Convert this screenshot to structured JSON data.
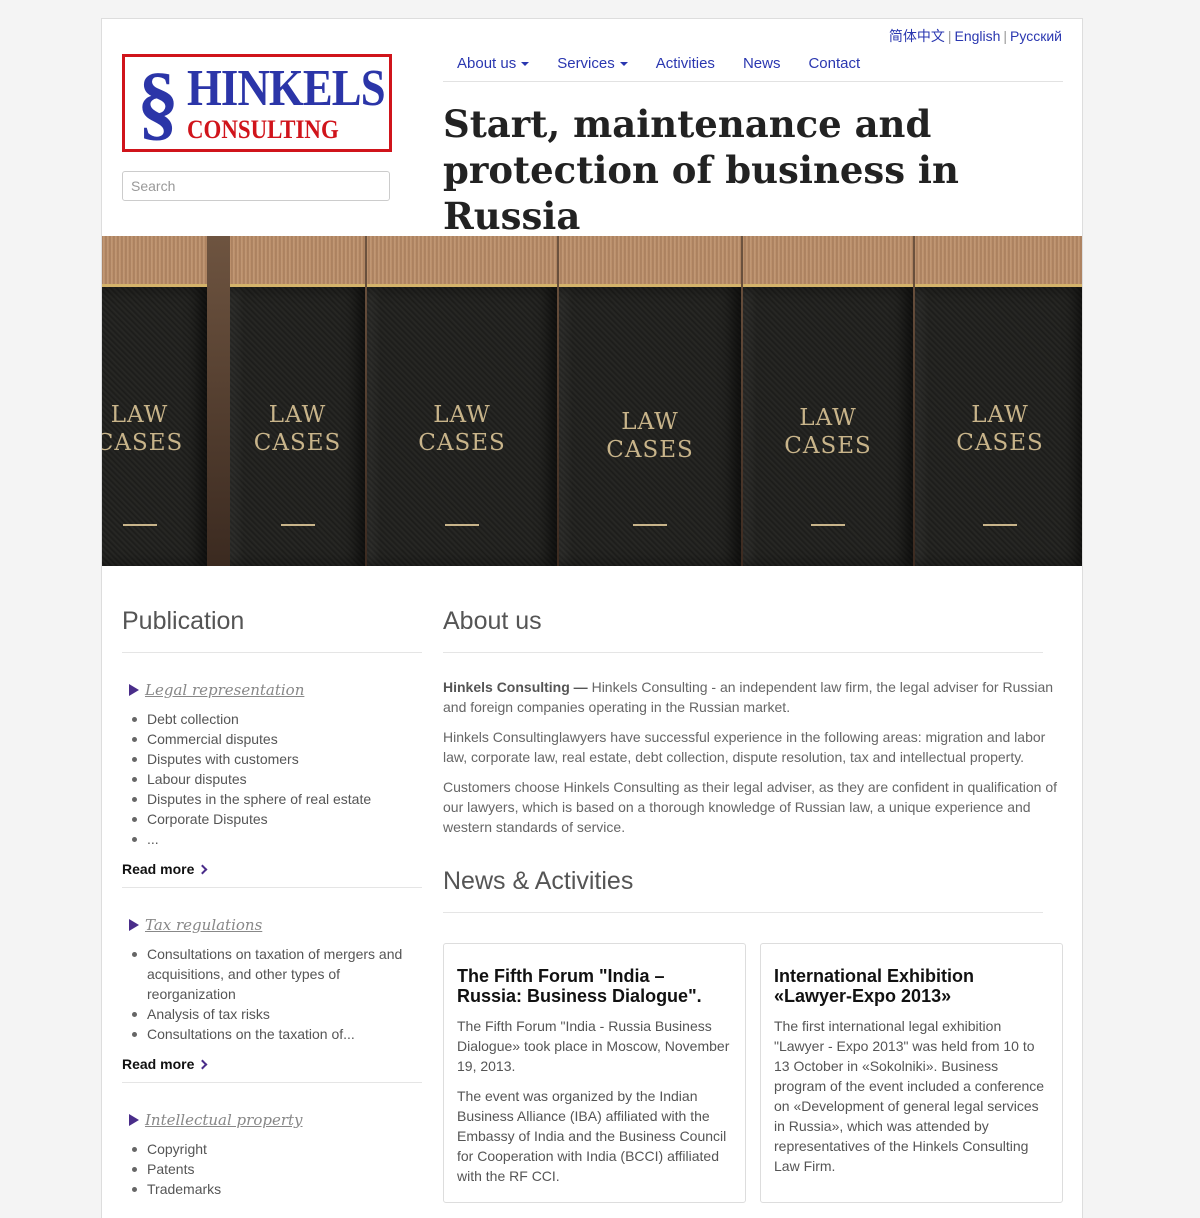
{
  "languages": {
    "zh": "简体中文",
    "en": "English",
    "ru": "Русский",
    "separator": "|"
  },
  "logo": {
    "symbol": "§",
    "line1": "HINKELS",
    "line2": "CONSULTING"
  },
  "search": {
    "placeholder": "Search"
  },
  "nav": {
    "items": [
      {
        "label": "About us",
        "dropdown": true
      },
      {
        "label": "Services",
        "dropdown": true
      },
      {
        "label": "Activities",
        "dropdown": false
      },
      {
        "label": "News",
        "dropdown": false
      },
      {
        "label": "Contact",
        "dropdown": false
      }
    ]
  },
  "tagline": "Start, maintenance and protection of business in Russia",
  "hero": {
    "book_title_line1": "LAW",
    "book_title_line2": "CASES"
  },
  "publication": {
    "heading": "Publication",
    "read_more": "Read more",
    "groups": [
      {
        "category": "Legal representation",
        "items": [
          "Debt collection",
          "Commercial disputes",
          "Disputes with customers",
          "Labour disputes",
          "Disputes in the sphere of real estate",
          "Corporate Disputes",
          "..."
        ]
      },
      {
        "category": "Tax regulations",
        "items": [
          "Consultations on taxation of mergers and acquisitions, and other types of reorganization",
          "Analysis of tax risks",
          "Consultations on the taxation of..."
        ]
      },
      {
        "category": "Intellectual property",
        "items": [
          "Copyright",
          "Patents",
          "Trademarks"
        ]
      }
    ]
  },
  "about": {
    "heading": "About us",
    "lead_bold": "Hinkels Consulting —",
    "p1": "Hinkels Consulting - an independent law firm, the legal adviser for Russian and foreign companies operating in the Russian market.",
    "p2": "Hinkels Consultinglawyers have successful experience in the following areas: migration and labor law, corporate law, real estate, debt collection, dispute resolution, tax and intellectual property.",
    "p3": "Customers choose Hinkels Consulting as their legal adviser, as they are confident in qualification of our lawyers, which is based on a thorough knowledge of Russian law, a unique experience and western standards of service."
  },
  "news": {
    "heading": "News & Activities",
    "cards": [
      {
        "title": "The Fifth Forum \"India – Russia: Business Dialogue\".",
        "p1": "The Fifth Forum \"India - Russia Business Dialogue» took place in Moscow, November 19, 2013.",
        "p2": "The event was organized by the Indian Business Alliance (IBA) affiliated with the Embassy of India and the Business Council for Cooperation with India (BCCI) affiliated with the RF CCI."
      },
      {
        "title": "International Exhibition «Lawyer-Expo 2013»",
        "p1": "The first international legal exhibition \"Lawyer - Expo 2013\" was held from 10 to 13 October in «Sokolniki». Business program of the event included a conference on «Development of general legal services in Russia», which was attended by representatives of the Hinkels Consulting Law Firm.",
        "p2": ""
      }
    ]
  },
  "colors": {
    "link": "#2a37b0",
    "brand_red": "#d0141b",
    "brand_blue": "#2b35a8",
    "accent_purple": "#4a2d8a"
  }
}
